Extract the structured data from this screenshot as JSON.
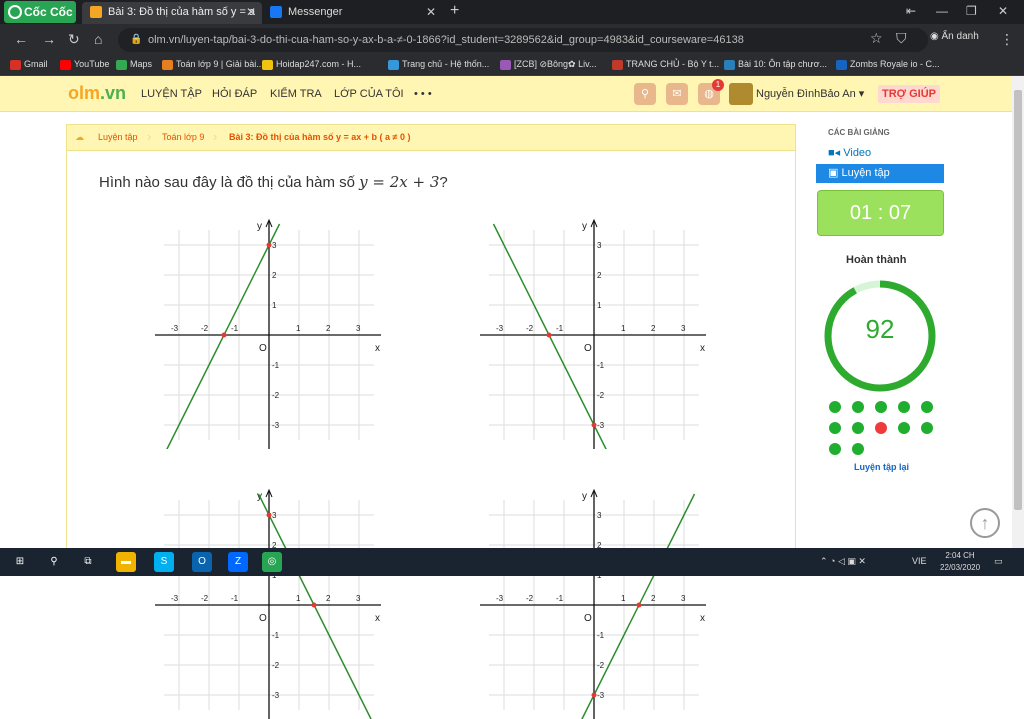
{
  "browser": {
    "brand": "Cốc Cốc",
    "tabs": [
      {
        "label": "Bài 3: Đồ thị của hàm số y = a"
      },
      {
        "label": "Messenger"
      }
    ],
    "url": "olm.vn/luyen-tap/bai-3-do-thi-cua-ham-so-y-ax-b-a-≠-0-1866?id_student=3289562&id_group=4983&id_courseware=46138",
    "anon_label": "Ẩn danh",
    "bookmarks": [
      {
        "label": "Gmail",
        "color": "#d93025"
      },
      {
        "label": "YouTube",
        "color": "#ff0000"
      },
      {
        "label": "Maps",
        "color": "#34a853"
      },
      {
        "label": "Toán lớp 9 | Giải bài...",
        "color": "#e67e22"
      },
      {
        "label": "Hoidap247.com - H...",
        "color": "#f1c40f"
      },
      {
        "label": "Trang chủ - Hệ thốn...",
        "color": "#3498db"
      },
      {
        "label": "[ZCB] ⊘Bông✿ Liv...",
        "color": "#9b59b6"
      },
      {
        "label": "TRANG CHỦ - Bộ Y t...",
        "color": "#c0392b"
      },
      {
        "label": "Bài 10: Ôn tập chươ...",
        "color": "#2980b9"
      },
      {
        "label": "Zombs Royale io - C...",
        "color": "#1565c0"
      }
    ]
  },
  "olm": {
    "logo_a": "olm",
    "logo_b": ".vn",
    "menu": [
      "LUYỆN TẬP",
      "HỎI ĐÁP",
      "KIỂM TRA",
      "LỚP CỦA TÔI",
      "• • •"
    ],
    "notification_count": "1",
    "user_name": "Nguyễn ĐìnhBảo An ▾",
    "help_label": "TRỢ GIÚP"
  },
  "breadcrumb": [
    "Luyện tập",
    "Toán lớp 9",
    "Bài 3: Đồ thị của hàm số y = ax + b ( a ≠ 0 )"
  ],
  "question": {
    "prefix": "Hình nào sau đây là đồ thị của hàm số ",
    "formula": "y = 2x + 3",
    "suffix": "?"
  },
  "graphs": {
    "tick_labels_x": [
      "-3",
      "-2",
      "-1",
      "1",
      "2",
      "3"
    ],
    "tick_labels_y": [
      "3",
      "2",
      "1",
      "-1",
      "-2",
      "-3"
    ],
    "origin": "O",
    "x_axis": "x",
    "y_axis": "y",
    "line_color": "#2e8b2e",
    "point_color": "#e53935",
    "options": [
      {
        "slope": 2,
        "intercept": 3
      },
      {
        "slope": -2,
        "intercept": -3
      },
      {
        "slope": -2,
        "intercept": 3
      },
      {
        "slope": 2,
        "intercept": -3
      }
    ]
  },
  "sidebar": {
    "section_label": "CÁC BÀI GIẢNG",
    "video_label": "Video",
    "practice_label": "Luyện tập",
    "timer": "01 : 07",
    "complete_label": "Hoàn thành",
    "score": "92",
    "progress": 0.92,
    "answers": [
      "correct",
      "correct",
      "correct",
      "correct",
      "correct",
      "correct",
      "correct",
      "wrong",
      "correct",
      "correct",
      "correct",
      "correct"
    ],
    "retry_label": "Luyện tập lại"
  },
  "taskbar": {
    "time": "2:04 CH",
    "date": "22/03/2020",
    "lang": "VIE"
  }
}
